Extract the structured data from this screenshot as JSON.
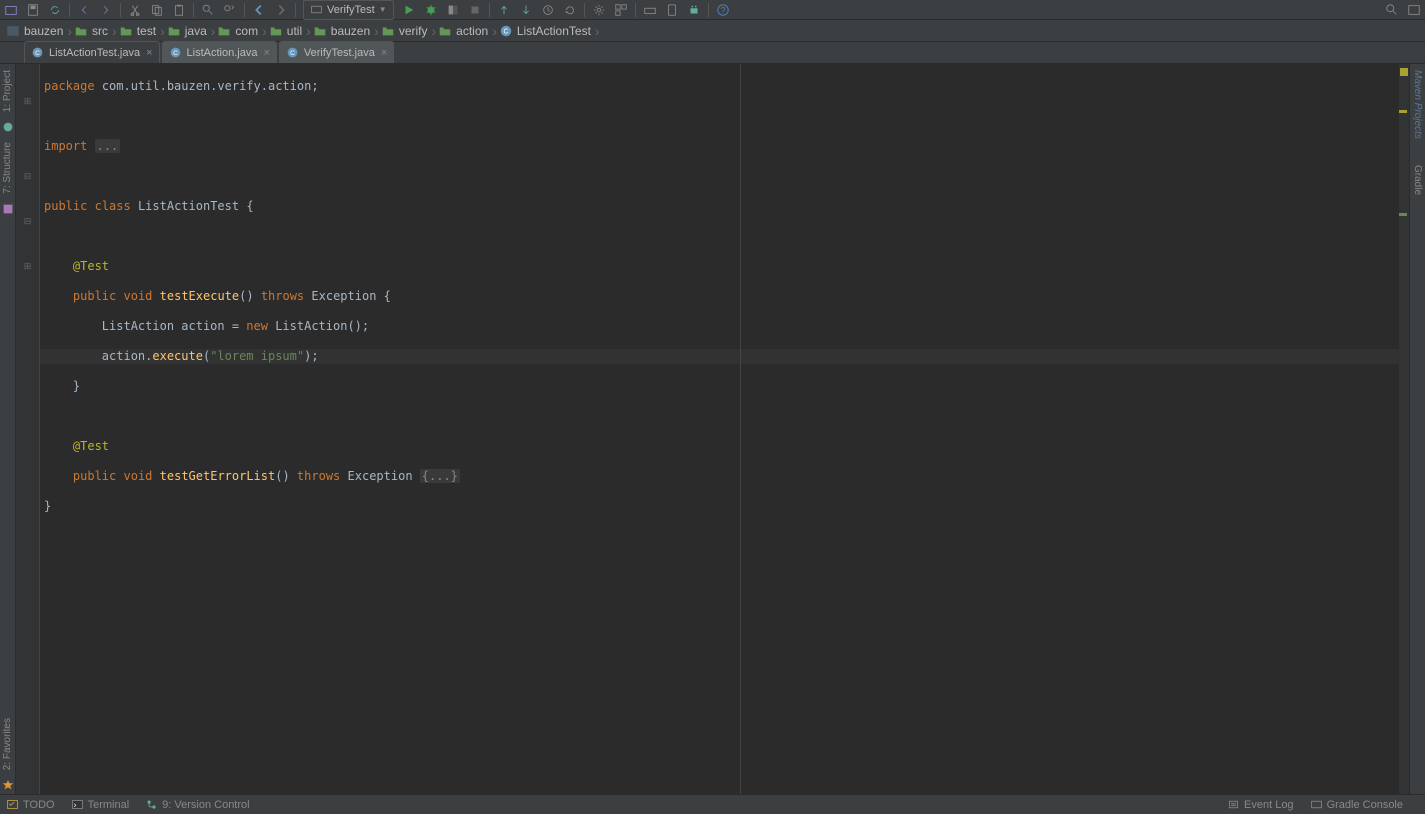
{
  "toolbar": {
    "runConfig": "VerifyTest"
  },
  "breadcrumbs": [
    {
      "icon": "module",
      "label": "bauzen"
    },
    {
      "icon": "folder",
      "label": "src"
    },
    {
      "icon": "folder",
      "label": "test"
    },
    {
      "icon": "folder",
      "label": "java"
    },
    {
      "icon": "folder",
      "label": "com"
    },
    {
      "icon": "folder",
      "label": "util"
    },
    {
      "icon": "folder",
      "label": "bauzen"
    },
    {
      "icon": "folder",
      "label": "verify"
    },
    {
      "icon": "folder",
      "label": "action"
    },
    {
      "icon": "class",
      "label": "ListActionTest"
    }
  ],
  "tabs": [
    {
      "label": "ListActionTest.java",
      "active": true
    },
    {
      "label": "ListAction.java",
      "active": false
    },
    {
      "label": "VerifyTest.java",
      "active": false
    }
  ],
  "code": {
    "package": "package",
    "packageName": "com.util.bauzen.verify.action",
    "import": "import",
    "importFold": "...",
    "public": "public",
    "class": "class",
    "className": "ListActionTest",
    "anno": "@Test",
    "void": "void",
    "m1": "testExecute",
    "throws": "throws",
    "exception": "Exception",
    "l1a": "ListAction action = ",
    "new": "new",
    "l1b": " ListAction();",
    "l2a": "action.",
    "exec": "execute",
    "l2b": "(",
    "strv": "\"lorem ipsum\"",
    "l2c": ");",
    "m2": "testGetErrorList",
    "fold2": "{...}"
  },
  "leftBar": {
    "project": "1: Project",
    "structure": "7: Structure",
    "favorites": "2: Favorites"
  },
  "rightBar": {
    "maven": "Maven Projects",
    "gradle": "Gradle"
  },
  "bottom": {
    "todo": "TODO",
    "terminal": "Terminal",
    "vcs": "9: Version Control",
    "eventLog": "Event Log",
    "gradleConsole": "Gradle Console"
  }
}
